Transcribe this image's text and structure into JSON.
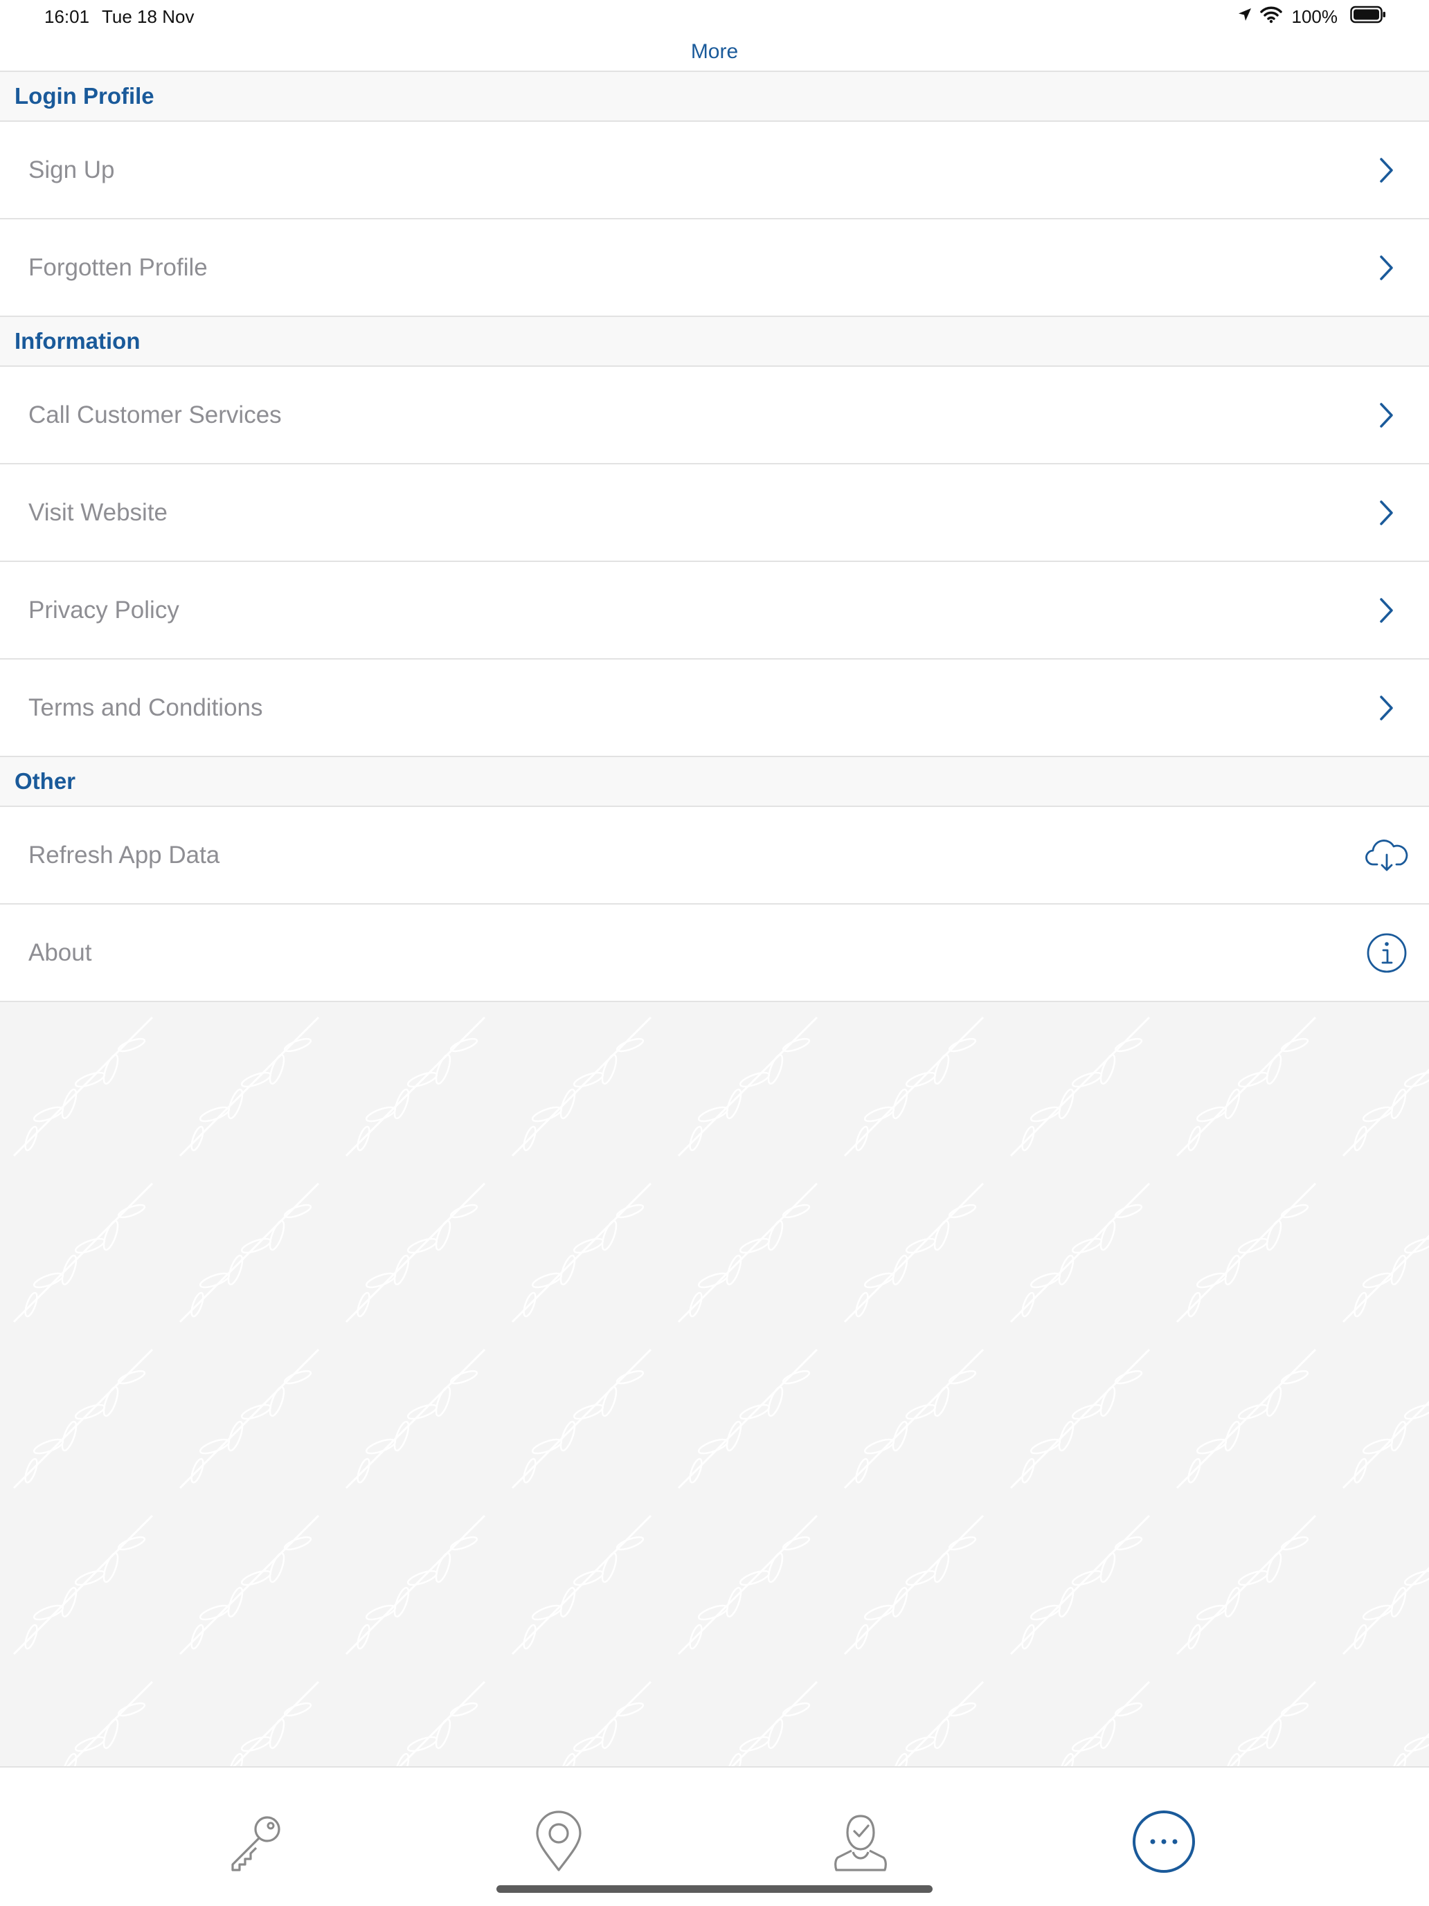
{
  "status_bar": {
    "time": "16:01",
    "date": "Tue 18 Nov",
    "battery": "100%"
  },
  "nav": {
    "title": "More"
  },
  "sections": [
    {
      "title": "Login Profile",
      "rows": [
        {
          "label": "Sign Up",
          "accessory": "chevron-right-icon"
        },
        {
          "label": "Forgotten Profile",
          "accessory": "chevron-right-icon"
        }
      ]
    },
    {
      "title": "Information",
      "rows": [
        {
          "label": "Call Customer Services",
          "accessory": "chevron-right-icon"
        },
        {
          "label": "Visit Website",
          "accessory": "chevron-right-icon"
        },
        {
          "label": "Privacy Policy",
          "accessory": "chevron-right-icon"
        },
        {
          "label": "Terms and Conditions",
          "accessory": "chevron-right-icon"
        }
      ]
    },
    {
      "title": "Other",
      "rows": [
        {
          "label": "Refresh App Data",
          "accessory": "cloud-download-icon"
        },
        {
          "label": "About",
          "accessory": "info-icon"
        }
      ]
    }
  ],
  "tab_bar": {
    "tabs": [
      {
        "icon": "key-icon",
        "selected": false
      },
      {
        "icon": "location-pin-icon",
        "selected": false
      },
      {
        "icon": "person-check-icon",
        "selected": false
      },
      {
        "icon": "more-icon",
        "selected": true
      }
    ]
  },
  "colors": {
    "accent": "#1a5a9a",
    "row_label": "#8e8e93",
    "inactive_tab": "#8a8a8a"
  }
}
